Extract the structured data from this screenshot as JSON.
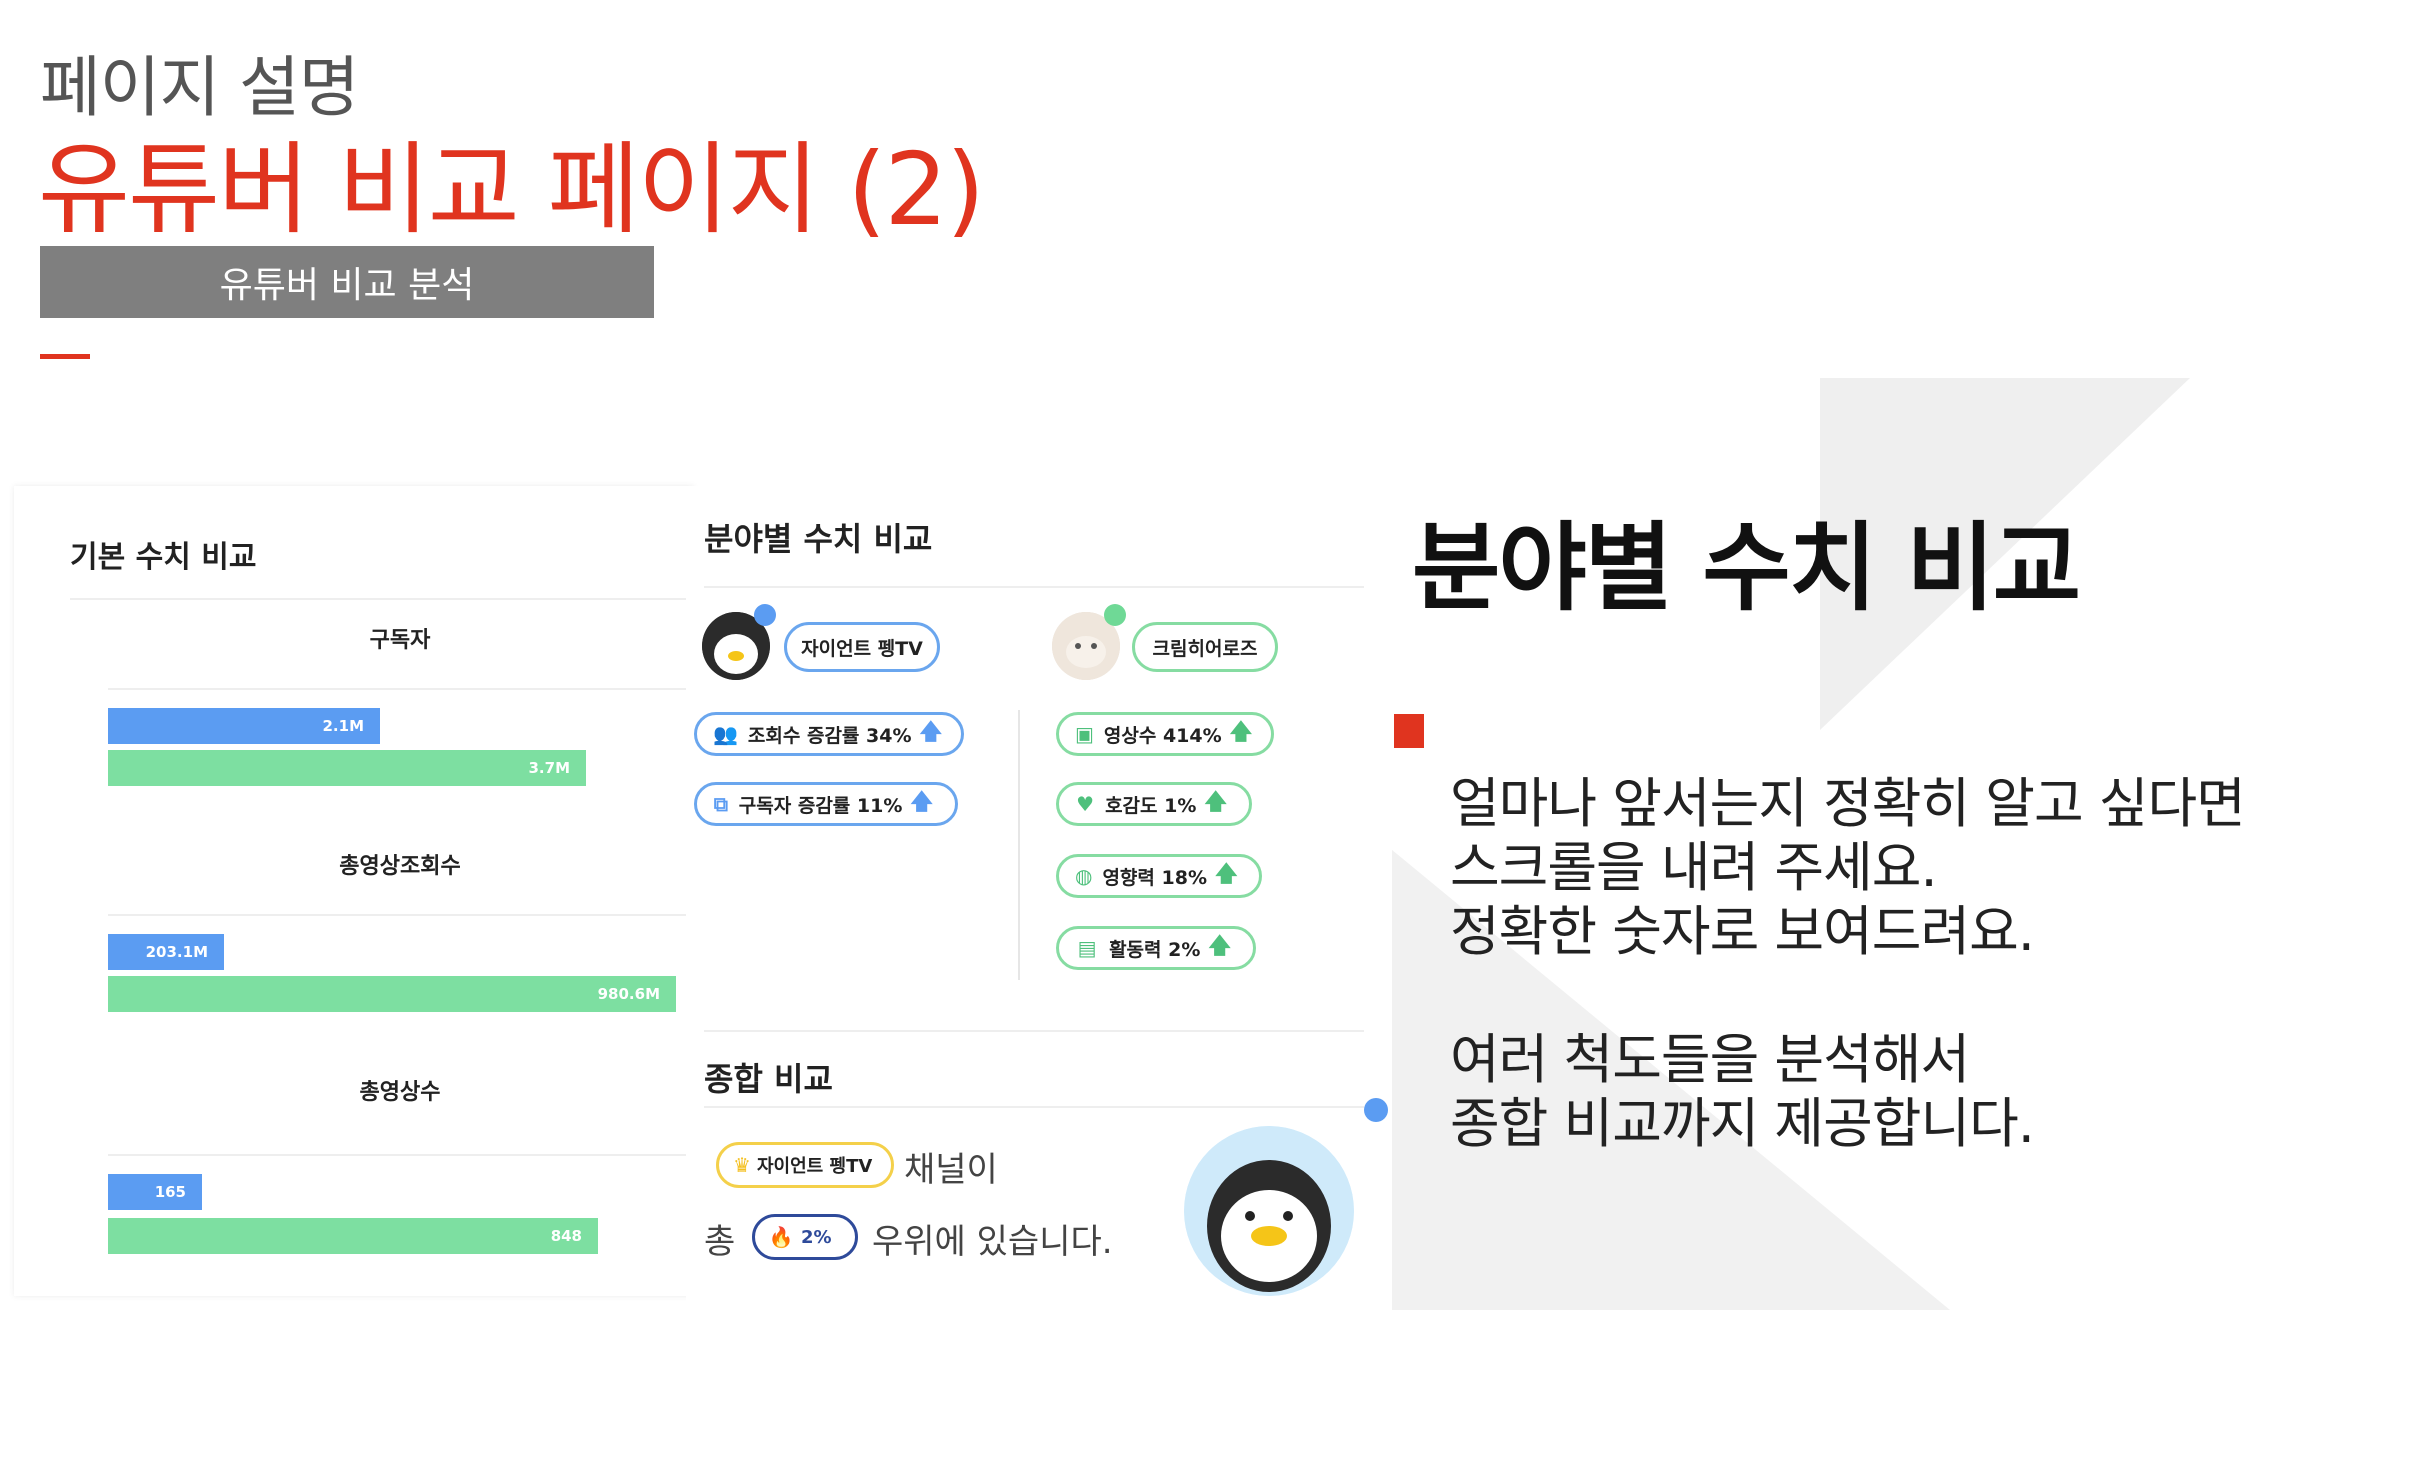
{
  "header": {
    "subtitle": "페이지 설명",
    "title": "유튜버 비교 페이지 (2)",
    "tab_label": "유튜버 비교 분석"
  },
  "basic_panel": {
    "title": "기본 수치 비교",
    "metrics": [
      {
        "label": "구독자",
        "blue_label": "2.1M",
        "green_label": "3.7M",
        "blue_value": 2.1,
        "green_value": 3.7
      },
      {
        "label": "총영상조회수",
        "blue_label": "203.1M",
        "green_label": "980.6M",
        "blue_value": 203.1,
        "green_value": 980.6
      },
      {
        "label": "총영상수",
        "blue_label": "165",
        "green_label": "848",
        "blue_value": 165,
        "green_value": 848
      }
    ],
    "colors": {
      "blue": "#5b9cf2",
      "green": "#7ddfa1"
    }
  },
  "field_panel": {
    "title": "분야별 수치 비교",
    "left_channel": {
      "name": "자이언트 펭TV",
      "stats": [
        {
          "label": "조회수 증감률 34%",
          "icon": "people-icon"
        },
        {
          "label": "구독자 증감률 11%",
          "icon": "video-stack-icon"
        }
      ]
    },
    "right_channel": {
      "name": "크림히어로즈",
      "stats": [
        {
          "label": "영상수 414%",
          "icon": "video-icon"
        },
        {
          "label": "호감도 1%",
          "icon": "heart-icon"
        },
        {
          "label": "영향력 18%",
          "icon": "globe-icon"
        },
        {
          "label": "활동력 2%",
          "icon": "card-icon"
        }
      ]
    }
  },
  "summary_panel": {
    "title": "종합 비교",
    "channel_badge": "자이언트 펭TV",
    "text_1": "채널이",
    "text_2": "총",
    "rank_badge": "2%",
    "text_3": "우위에 있습니다."
  },
  "right": {
    "heading": "분야별 수치 비교",
    "desc_lines": [
      "얼마나 앞서는지 정확히 알고 싶다면",
      "스크롤을 내려 주세요.",
      "정확한 숫자로 보여드려요.",
      "",
      "여러 척도들을 분석해서",
      "종합 비교까지 제공합니다."
    ]
  },
  "accent_color": "#e0341f"
}
